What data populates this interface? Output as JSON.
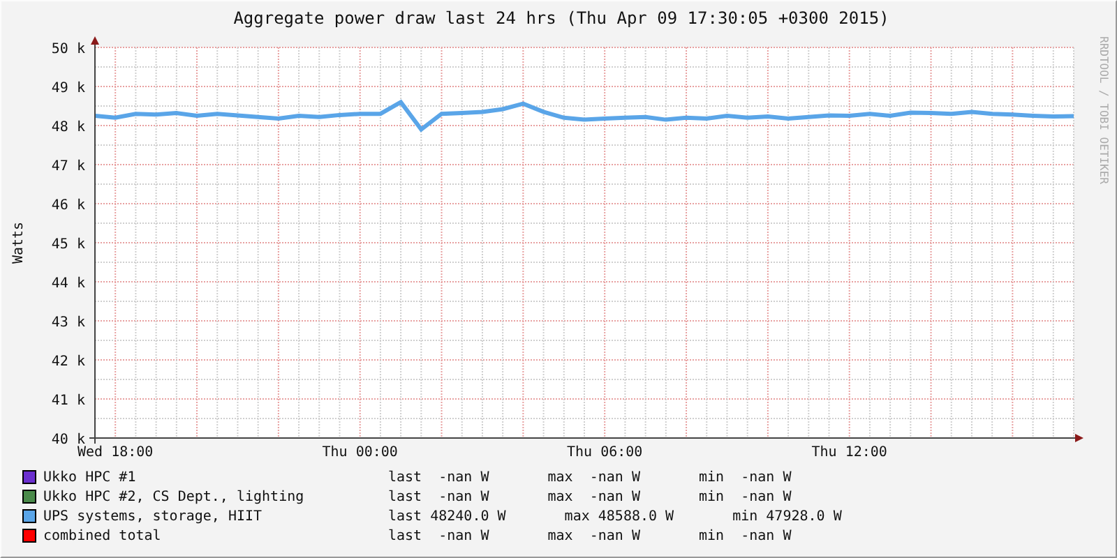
{
  "chart_data": {
    "type": "line",
    "title": "Aggregate power draw last 24 hrs (Thu Apr 09 17:30:05 +0300 2015)",
    "ylabel": "Watts",
    "categories": [
      null,
      "Wed 18:00",
      null,
      null,
      null,
      null,
      null,
      null,
      null,
      null,
      null,
      null,
      null,
      "Thu 00:00",
      null,
      null,
      null,
      null,
      null,
      null,
      null,
      null,
      null,
      null,
      null,
      "Thu 06:00",
      null,
      null,
      null,
      null,
      null,
      null,
      null,
      null,
      null,
      null,
      null,
      "Thu 12:00",
      null,
      null,
      null,
      null,
      null,
      null,
      null,
      null,
      null,
      null,
      null
    ],
    "series": [
      {
        "color": "#5aa5e8",
        "values": [
          48250,
          48200,
          48300,
          48280,
          48320,
          48250,
          48300,
          48260,
          48220,
          48180,
          48250,
          48220,
          48270,
          48300,
          48300,
          48600,
          47900,
          48300,
          48320,
          48350,
          48420,
          48560,
          48350,
          48200,
          48150,
          48180,
          48200,
          48220,
          48150,
          48200,
          48180,
          48250,
          48200,
          48230,
          48180,
          48220,
          48260,
          48250,
          48300,
          48250,
          48330,
          48320,
          48300,
          48350,
          48300,
          48280,
          48250,
          48230,
          48240
        ]
      }
    ],
    "ylim": [
      40000,
      50000
    ],
    "grid": true,
    "yticks": [
      {
        "value": 40000,
        "label": "40 k"
      },
      {
        "value": 41000,
        "label": "41 k"
      },
      {
        "value": 42000,
        "label": "42 k"
      },
      {
        "value": 43000,
        "label": "43 k"
      },
      {
        "value": 44000,
        "label": "44 k"
      },
      {
        "value": 45000,
        "label": "45 k"
      },
      {
        "value": 46000,
        "label": "46 k"
      },
      {
        "value": 47000,
        "label": "47 k"
      },
      {
        "value": 48000,
        "label": "48 k"
      },
      {
        "value": 49000,
        "label": "49 k"
      },
      {
        "value": 50000,
        "label": "50 k"
      }
    ]
  },
  "credit": "RRDTOOL / TOBI OETIKER",
  "legend": [
    {
      "name": "Ukko HPC #1",
      "color": "#6b2fcf",
      "stats": [
        "last  -nan W",
        "max  -nan W",
        "min  -nan W"
      ]
    },
    {
      "name": "Ukko HPC #2, CS Dept., lighting",
      "color": "#4a8a4a",
      "stats": [
        "last  -nan W",
        "max  -nan W",
        "min  -nan W"
      ]
    },
    {
      "name": "UPS systems, storage, HIIT",
      "color": "#5aa5e8",
      "stats": [
        "last 48240.0 W",
        "max 48588.0 W",
        "min 47928.0 W"
      ]
    },
    {
      "name": "combined total",
      "color": "#ff0000",
      "stats": [
        "last  -nan W",
        "max  -nan W",
        "min  -nan W"
      ]
    }
  ]
}
